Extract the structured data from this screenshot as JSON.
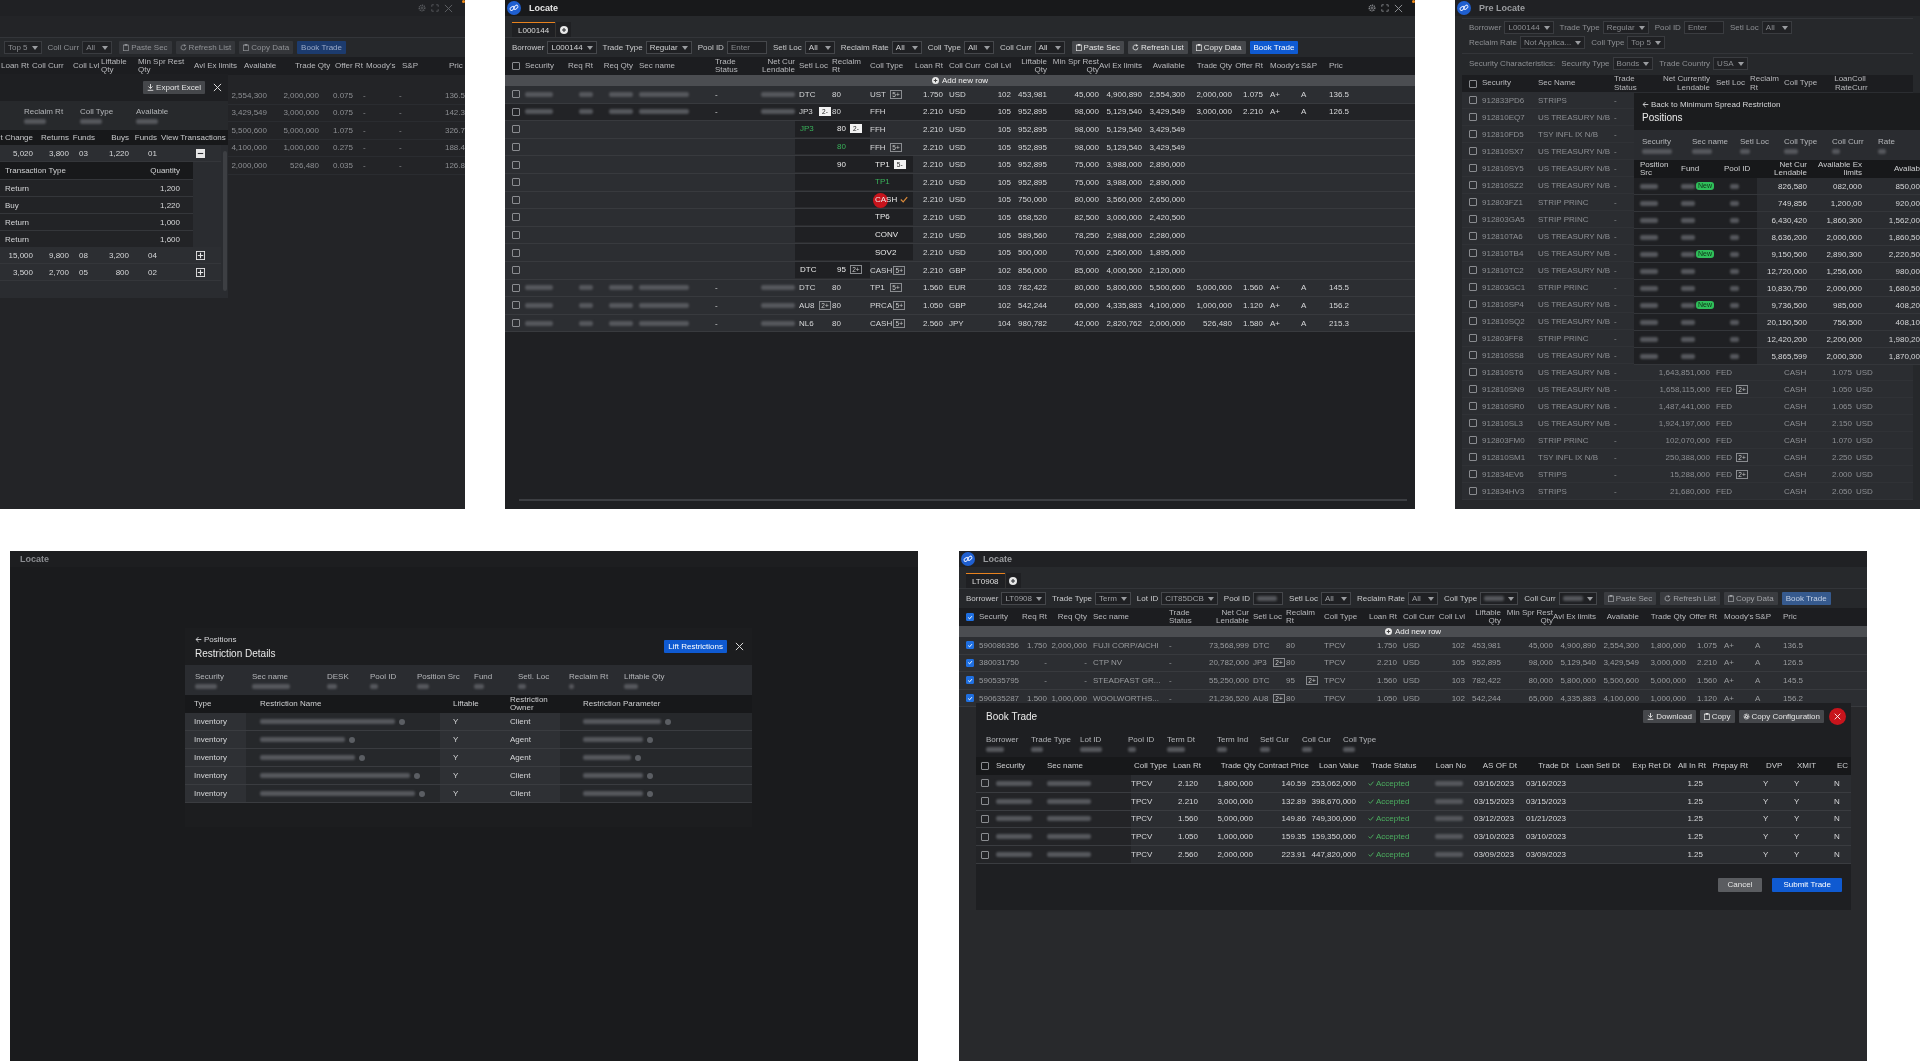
{
  "balances_window": {
    "filters": [
      {
        "value": "Top 5"
      },
      {
        "label": "Coll Curr",
        "value": "All"
      }
    ],
    "buttons": [
      {
        "label": "Paste Sec",
        "kind": "paste"
      },
      {
        "label": "Refresh List",
        "kind": "refresh"
      },
      {
        "label": "Copy Data",
        "kind": "copy"
      },
      {
        "label": "Book Trade",
        "kind": "primary"
      }
    ],
    "columns": [
      "Loan Rt",
      "Coll Curr",
      "Coll Lvl",
      "Liftable Qty",
      "Min Spr Rest Qty",
      "Avl Ex limits",
      "Available",
      "Trade Qty",
      "Offer Rt",
      "Moody's",
      "S&P",
      "Pric"
    ],
    "rows": [
      {
        "available": "2,554,300",
        "trade_qty": "2,000,000",
        "offer_rt": "0.075",
        "moodys": "-",
        "sp": "-",
        "price": "136.5"
      },
      {
        "available": "3,429,549",
        "trade_qty": "3,000,000",
        "offer_rt": "0.075",
        "moodys": "-",
        "sp": "-",
        "price": "142.3"
      },
      {
        "available": "5,500,600",
        "trade_qty": "5,000,000",
        "offer_rt": "1.075",
        "moodys": "-",
        "sp": "-",
        "price": "326.7"
      },
      {
        "available": "4,100,000",
        "trade_qty": "1,000,000",
        "offer_rt": "0.275",
        "moodys": "-",
        "sp": "-",
        "price": "188.4"
      },
      {
        "available": "2,000,000",
        "trade_qty": "526,480",
        "offer_rt": "0.035",
        "moodys": "-",
        "sp": "-",
        "price": "126.8"
      }
    ],
    "drawer": {
      "export_button": "Export Excel",
      "summary": [
        "Reclaim Rt",
        "Coll Type",
        "Available"
      ],
      "columns": [
        "t Change",
        "Returns",
        "Funds",
        "Buys",
        "Funds",
        "View Transactions"
      ],
      "rows": [
        {
          "cells": [
            "5,020",
            "3,800",
            "03",
            "1,220",
            "01"
          ],
          "expanded": true,
          "transactions": {
            "columns": [
              "Transaction Type",
              "Quantity"
            ],
            "rows": [
              [
                "Return",
                "1,200"
              ],
              [
                "Buy",
                "1,220"
              ],
              [
                "Return",
                "1,000"
              ],
              [
                "Return",
                "1,600"
              ]
            ]
          }
        },
        {
          "cells": [
            "15,000",
            "9,800",
            "08",
            "3,200",
            "04"
          ],
          "expanded": false
        },
        {
          "cells": [
            "3,500",
            "2,700",
            "05",
            "800",
            "02"
          ],
          "expanded": false
        }
      ]
    }
  },
  "locate_window": {
    "title": "Locate",
    "tab": {
      "label": "L000144",
      "selected": true
    },
    "filters": [
      {
        "label": "Borrower",
        "value": "L000144"
      },
      {
        "label": "Trade Type",
        "value": "Regular"
      },
      {
        "label": "Pool ID",
        "placeholder": "Enter"
      },
      {
        "label": "Setl Loc",
        "value": "All"
      },
      {
        "label": "Reclaim Rate",
        "value": "All"
      },
      {
        "label": "Coll Type",
        "value": "All"
      },
      {
        "label": "Coll Curr",
        "value": "All"
      }
    ],
    "buttons": [
      {
        "label": "Paste Sec",
        "kind": "paste"
      },
      {
        "label": "Refresh List",
        "kind": "refresh"
      },
      {
        "label": "Copy Data",
        "kind": "copy"
      },
      {
        "label": "Book Trade",
        "kind": "primary"
      }
    ],
    "all_checked": false,
    "columns": [
      "Security",
      "Req Rt",
      "Req Qty",
      "Sec name",
      "Trade Status",
      "Net Cur Lendable",
      "Setl Loc",
      "Reclaim Rt",
      "Coll Type",
      "Loan Rt",
      "Coll Curr",
      "Coll Lvl",
      "Liftable Qty",
      "Min Spr Rest Qty",
      "Avl Ex limits",
      "Available",
      "Trade Qty",
      "Offer Rt",
      "Moody's",
      "S&P",
      "Pric"
    ],
    "add_row": "Add new row",
    "rows": [
      {
        "checked": false,
        "blurred": true,
        "highlighted": false,
        "trade_status": "-",
        "setl_loc": {
          "text": "DTC"
        },
        "reclaim_rt": {
          "text": "80"
        },
        "coll_type": {
          "text": "UST",
          "badge": {
            "text": "5+",
            "expanded": false
          }
        },
        "loan_rt": "1.750",
        "coll_curr": "USD",
        "coll_lvl": "102",
        "liftable_qty": "453,981",
        "min_spr_rest_qty": "45,000",
        "avl_ex_limits": "4,900,890",
        "available": "2,554,300",
        "trade_qty": "2,000,000",
        "offer_rt": "1.075",
        "moodys": "A+",
        "sp": "A",
        "price": "136.5"
      },
      {
        "checked": false,
        "blurred": true,
        "highlighted": true,
        "trade_status": "-",
        "setl_loc": {
          "text": "JP3",
          "badge": {
            "text": "2-",
            "expanded": true
          }
        },
        "reclaim_rt": {
          "text": "80"
        },
        "coll_type": {
          "text": "FFH"
        },
        "loan_rt": "2.210",
        "coll_curr": "USD",
        "coll_lvl": "105",
        "liftable_qty": "952,895",
        "min_spr_rest_qty": "98,000",
        "avl_ex_limits": "5,129,540",
        "available": "3,429,549",
        "trade_qty": "3,000,000",
        "offer_rt": "2.210",
        "moodys": "A+",
        "sp": "A",
        "price": "126.5"
      },
      {
        "checked": false,
        "blurred": false,
        "highlighted": false,
        "setl_loc": {
          "kind": "option",
          "text": "JP3",
          "selected": true
        },
        "reclaim_rt": {
          "kind": "option",
          "text": "80",
          "selected": false,
          "badge": {
            "text": "2-",
            "expanded": true
          }
        },
        "coll_type": {
          "text": "FFH"
        },
        "loan_rt": "2.210",
        "coll_curr": "USD",
        "coll_lvl": "105",
        "liftable_qty": "952,895",
        "min_spr_rest_qty": "98,000",
        "avl_ex_limits": "5,129,540",
        "available": "3,429,549"
      },
      {
        "checked": false,
        "blurred": false,
        "highlighted": false,
        "setl_loc": {
          "kind": "option"
        },
        "reclaim_rt": {
          "kind": "option",
          "text": "80",
          "selected": true
        },
        "coll_type": {
          "text": "FFH",
          "badge": {
            "text": "5+",
            "expanded": false
          }
        },
        "loan_rt": "2.210",
        "coll_curr": "USD",
        "coll_lvl": "105",
        "liftable_qty": "952,895",
        "min_spr_rest_qty": "98,000",
        "avl_ex_limits": "5,129,540",
        "available": "3,429,549"
      },
      {
        "checked": false,
        "blurred": false,
        "highlighted": false,
        "setl_loc": {
          "kind": "option"
        },
        "reclaim_rt": {
          "kind": "option",
          "text": "90",
          "selected": false
        },
        "coll_type": {
          "kind": "option",
          "text": "TP1",
          "selected": false,
          "badge": {
            "text": "5-",
            "expanded": true
          }
        },
        "loan_rt": "2.210",
        "coll_curr": "USD",
        "coll_lvl": "105",
        "liftable_qty": "952,895",
        "min_spr_rest_qty": "75,000",
        "avl_ex_limits": "3,988,000",
        "available": "2,890,000"
      },
      {
        "checked": false,
        "blurred": false,
        "highlighted": false,
        "setl_loc": {
          "kind": "option"
        },
        "reclaim_rt": {
          "kind": "option"
        },
        "coll_type": {
          "kind": "option",
          "text": "TP1",
          "selected": true,
          "checked": false
        },
        "loan_rt": "2.210",
        "coll_curr": "USD",
        "coll_lvl": "105",
        "liftable_qty": "952,895",
        "min_spr_rest_qty": "75,000",
        "avl_ex_limits": "3,988,000",
        "available": "2,890,000"
      },
      {
        "checked": false,
        "blurred": false,
        "highlighted": false,
        "setl_loc": {
          "kind": "option"
        },
        "reclaim_rt": {
          "kind": "option"
        },
        "coll_type": {
          "kind": "option",
          "text": "CASH",
          "selected": false,
          "checked": true,
          "clicked": true
        },
        "loan_rt": "2.210",
        "coll_curr": "USD",
        "coll_lvl": "105",
        "liftable_qty": "750,000",
        "min_spr_rest_qty": "80,000",
        "avl_ex_limits": "3,560,000",
        "available": "2,650,000"
      },
      {
        "checked": false,
        "blurred": false,
        "highlighted": false,
        "setl_loc": {
          "kind": "option"
        },
        "reclaim_rt": {
          "kind": "option"
        },
        "coll_type": {
          "kind": "option",
          "text": "TP6",
          "selected": false,
          "checked": false
        },
        "loan_rt": "2.210",
        "coll_curr": "USD",
        "coll_lvl": "105",
        "liftable_qty": "658,520",
        "min_spr_rest_qty": "82,500",
        "avl_ex_limits": "3,000,000",
        "available": "2,420,500"
      },
      {
        "checked": false,
        "blurred": false,
        "highlighted": false,
        "setl_loc": {
          "kind": "option"
        },
        "reclaim_rt": {
          "kind": "option"
        },
        "coll_type": {
          "kind": "option",
          "text": "CONV",
          "selected": false,
          "checked": false
        },
        "loan_rt": "2.210",
        "coll_curr": "USD",
        "coll_lvl": "105",
        "liftable_qty": "589,560",
        "min_spr_rest_qty": "78,250",
        "avl_ex_limits": "2,988,000",
        "available": "2,280,000"
      },
      {
        "checked": false,
        "blurred": false,
        "highlighted": false,
        "setl_loc": {
          "kind": "option"
        },
        "reclaim_rt": {
          "kind": "option"
        },
        "coll_type": {
          "kind": "option",
          "text": "SOV2",
          "selected": false,
          "checked": false
        },
        "loan_rt": "2.210",
        "coll_curr": "USD",
        "coll_lvl": "105",
        "liftable_qty": "500,000",
        "min_spr_rest_qty": "70,000",
        "avl_ex_limits": "2,560,000",
        "available": "1,895,000"
      },
      {
        "checked": false,
        "blurred": false,
        "highlighted": false,
        "setl_loc": {
          "kind": "option",
          "text": "DTC",
          "selected": false
        },
        "reclaim_rt": {
          "kind": "option",
          "text": "95",
          "selected": false,
          "badge": {
            "text": "2+",
            "expanded": false
          }
        },
        "coll_type": {
          "text": "CASH",
          "badge": {
            "text": "5+",
            "expanded": false
          }
        },
        "loan_rt": "2.210",
        "coll_curr": "GBP",
        "coll_lvl": "102",
        "liftable_qty": "856,000",
        "min_spr_rest_qty": "85,000",
        "avl_ex_limits": "4,000,500",
        "available": "2,120,000"
      },
      {
        "checked": false,
        "blurred": true,
        "highlighted": false,
        "trade_status": "-",
        "setl_loc": {
          "text": "DTC"
        },
        "reclaim_rt": {
          "text": "80"
        },
        "coll_type": {
          "text": "TP1",
          "badge": {
            "text": "5+",
            "expanded": false
          }
        },
        "loan_rt": "1.560",
        "coll_curr": "EUR",
        "coll_lvl": "103",
        "liftable_qty": "782,422",
        "min_spr_rest_qty": "80,000",
        "avl_ex_limits": "5,800,000",
        "available": "5,500,600",
        "trade_qty": "5,000,000",
        "offer_rt": "1.560",
        "moodys": "A+",
        "sp": "A",
        "price": "145.5"
      },
      {
        "checked": false,
        "blurred": true,
        "highlighted": false,
        "trade_status": "-",
        "setl_loc": {
          "text": "AU8",
          "badge": {
            "text": "2+",
            "expanded": false
          }
        },
        "reclaim_rt": {
          "text": "80"
        },
        "coll_type": {
          "text": "PRCA",
          "badge": {
            "text": "5+",
            "expanded": false
          }
        },
        "loan_rt": "1.050",
        "coll_curr": "GBP",
        "coll_lvl": "102",
        "liftable_qty": "542,244",
        "min_spr_rest_qty": "65,000",
        "avl_ex_limits": "4,335,883",
        "available": "4,100,000",
        "trade_qty": "1,000,000",
        "offer_rt": "1.120",
        "moodys": "A+",
        "sp": "A",
        "price": "156.2"
      },
      {
        "checked": false,
        "blurred": true,
        "highlighted": false,
        "trade_status": "-",
        "setl_loc": {
          "text": "NL6"
        },
        "reclaim_rt": {
          "text": "80"
        },
        "coll_type": {
          "text": "CASH",
          "badge": {
            "text": "5+",
            "expanded": false
          }
        },
        "loan_rt": "2.560",
        "coll_curr": "JPY",
        "coll_lvl": "104",
        "liftable_qty": "980,782",
        "min_spr_rest_qty": "42,000",
        "avl_ex_limits": "2,820,762",
        "available": "2,000,000",
        "trade_qty": "526,480",
        "offer_rt": "1.580",
        "moodys": "A+",
        "sp": "A",
        "price": "215.3"
      }
    ]
  },
  "pre_locate_window": {
    "title": "Pre Locate",
    "filters": [
      {
        "label": "Borrower",
        "value": "L000144"
      },
      {
        "label": "Trade Type",
        "value": "Regular"
      },
      {
        "label": "Pool ID",
        "placeholder": "Enter"
      },
      {
        "label": "Setl Loc",
        "value": "All"
      },
      {
        "label": "Reclaim Rate",
        "value": "Not Applica..."
      },
      {
        "label": "Coll Type",
        "value": "Top 5"
      }
    ],
    "characteristics": {
      "label": "Security Characteristics:",
      "filters": [
        {
          "label": "Security Type",
          "value": "Bonds"
        },
        {
          "label": "Trade Country",
          "value": "USA"
        }
      ]
    },
    "all_checked": false,
    "columns": [
      "Security",
      "Sec Name",
      "Trade Status",
      "Net Currently Lendable",
      "Setl Loc",
      "Reclaim Rt",
      "Coll Type",
      "Loan Rate",
      "Coll Curr"
    ],
    "rows": [
      {
        "checked": false,
        "security": "912833PD6",
        "sec_name": "STRIPS",
        "trade_status": "-"
      },
      {
        "checked": false,
        "security": "912810EQ7",
        "sec_name": "US TREASURY N/B",
        "trade_status": "-"
      },
      {
        "checked": false,
        "security": "912810FD5",
        "sec_name": "TSY INFL IX N/B",
        "trade_status": "-"
      },
      {
        "checked": false,
        "security": "912810SX7",
        "sec_name": "US TREASURY N/B",
        "trade_status": "-"
      },
      {
        "checked": false,
        "security": "912810SY5",
        "sec_name": "US TREASURY N/B",
        "trade_status": "-"
      },
      {
        "checked": false,
        "security": "912810SZ2",
        "sec_name": "US TREASURY N/B",
        "trade_status": "-"
      },
      {
        "checked": false,
        "security": "912803FZ1",
        "sec_name": "STRIP PRINC",
        "trade_status": "-"
      },
      {
        "checked": false,
        "security": "912803GA5",
        "sec_name": "STRIP PRINC",
        "trade_status": "-"
      },
      {
        "checked": false,
        "security": "912810TA6",
        "sec_name": "US TREASURY N/B",
        "trade_status": "-"
      },
      {
        "checked": false,
        "security": "912810TB4",
        "sec_name": "US TREASURY N/B",
        "trade_status": "-"
      },
      {
        "checked": false,
        "security": "912810TC2",
        "sec_name": "US TREASURY N/B",
        "trade_status": "-"
      },
      {
        "checked": false,
        "security": "912803GC1",
        "sec_name": "STRIP PRINC",
        "trade_status": "-"
      },
      {
        "checked": false,
        "security": "912810SP4",
        "sec_name": "US TREASURY N/B",
        "trade_status": "-"
      },
      {
        "checked": false,
        "security": "912810SQ2",
        "sec_name": "US TREASURY N/B",
        "trade_status": "-"
      },
      {
        "checked": false,
        "security": "912803FF8",
        "sec_name": "STRIP PRINC",
        "trade_status": "-"
      },
      {
        "checked": false,
        "security": "912810SS8",
        "sec_name": "US TREASURY N/B",
        "trade_status": "-"
      },
      {
        "checked": false,
        "security": "912810ST6",
        "sec_name": "US TREASURY N/B",
        "trade_status": "-",
        "net_currently_lendable": "1,643,851,000",
        "setl_loc": "FED",
        "coll_type": "CASH",
        "loan_rate": "1.075",
        "coll_curr": "USD"
      },
      {
        "checked": false,
        "security": "912810SN9",
        "sec_name": "US TREASURY N/B",
        "trade_status": "-",
        "net_currently_lendable": "1,658,115,000",
        "setl_loc": "FED",
        "badge": "2+",
        "coll_type": "CASH",
        "loan_rate": "1.050",
        "coll_curr": "USD"
      },
      {
        "checked": false,
        "security": "912810SR0",
        "sec_name": "US TREASURY N/B",
        "trade_status": "-",
        "net_currently_lendable": "1,487,441,000",
        "setl_loc": "FED",
        "coll_type": "CASH",
        "loan_rate": "1.065",
        "coll_curr": "USD"
      },
      {
        "checked": false,
        "security": "912810SL3",
        "sec_name": "US TREASURY N/B",
        "trade_status": "-",
        "net_currently_lendable": "1,924,197,000",
        "setl_loc": "FED",
        "coll_type": "CASH",
        "loan_rate": "2.150",
        "coll_curr": "USD"
      },
      {
        "checked": false,
        "security": "912803FM0",
        "sec_name": "STRIP PRINC",
        "trade_status": "-",
        "net_currently_lendable": "102,070,000",
        "setl_loc": "FED",
        "coll_type": "CASH",
        "loan_rate": "1.070",
        "coll_curr": "USD"
      },
      {
        "checked": false,
        "security": "912810SM1",
        "sec_name": "TSY INFL IX N/B",
        "trade_status": "-",
        "net_currently_lendable": "250,388,000",
        "setl_loc": "FED",
        "badge": "2+",
        "coll_type": "CASH",
        "loan_rate": "2.250",
        "coll_curr": "USD"
      },
      {
        "checked": false,
        "security": "912834EV6",
        "sec_name": "STRIPS",
        "trade_status": "-",
        "net_currently_lendable": "15,288,000",
        "setl_loc": "FED",
        "badge": "2+",
        "coll_type": "CASH",
        "loan_rate": "2.000",
        "coll_curr": "USD"
      },
      {
        "checked": false,
        "security": "912834HV3",
        "sec_name": "STRIPS",
        "trade_status": "-",
        "net_currently_lendable": "21,680,000",
        "setl_loc": "FED",
        "coll_type": "CASH",
        "loan_rate": "2.050",
        "coll_curr": "USD"
      }
    ],
    "positions": {
      "back_link": "Back to Minimum Spread Restriction",
      "title": "Positions",
      "summary": [
        "Security",
        "Sec name",
        "Setl Loc",
        "Coll Type",
        "Coll Curr",
        "Rate"
      ],
      "columns": [
        "Position Src",
        "Fund",
        "Pool ID",
        "Net Cur Lendable",
        "Available Ex limits",
        "Availab"
      ],
      "rows": [
        {
          "badge": "New",
          "net_cur_lendable": "826,580",
          "available_ex_limits": "082,000",
          "available": "850,00"
        },
        {
          "net_cur_lendable": "749,856",
          "available_ex_limits": "1,200,00",
          "available": "920,00"
        },
        {
          "net_cur_lendable": "6,430,420",
          "available_ex_limits": "1,860,300",
          "available": "1,562,00"
        },
        {
          "net_cur_lendable": "8,636,200",
          "available_ex_limits": "2,000,000",
          "available": "1,860,50"
        },
        {
          "badge": "New",
          "net_cur_lendable": "9,150,500",
          "available_ex_limits": "2,890,300",
          "available": "2,220,50"
        },
        {
          "net_cur_lendable": "12,720,000",
          "available_ex_limits": "1,256,000",
          "available": "980,00"
        },
        {
          "net_cur_lendable": "10,830,750",
          "available_ex_limits": "2,000,000",
          "available": "1,680,50"
        },
        {
          "badge": "New",
          "net_cur_lendable": "9,736,500",
          "available_ex_limits": "985,000",
          "available": "408,20"
        },
        {
          "net_cur_lendable": "20,150,500",
          "available_ex_limits": "756,500",
          "available": "408,10"
        },
        {
          "net_cur_lendable": "12,420,200",
          "available_ex_limits": "2,200,000",
          "available": "1,980,20"
        },
        {
          "net_cur_lendable": "5,865,599",
          "available_ex_limits": "2,000,300",
          "available": "1,870,00"
        }
      ]
    }
  },
  "restriction_window": {
    "title": "Locate",
    "dialog": {
      "back_link": "Positions",
      "title": "Restriction Details",
      "button": "Lift Restrictions",
      "summary": [
        "Security",
        "Sec name",
        "DESK",
        "Pool ID",
        "Position Src",
        "Fund",
        "Setl. Loc",
        "Reclaim Rt",
        "Liftable Qty"
      ],
      "columns": [
        "Type",
        "Restriction Name",
        "Liftable",
        "Restriction Owner",
        "Restriction Parameter"
      ],
      "rows": [
        {
          "type": "Inventory",
          "liftable": "Y",
          "owner": "Client"
        },
        {
          "type": "Inventory",
          "liftable": "Y",
          "owner": "Agent"
        },
        {
          "type": "Inventory",
          "liftable": "Y",
          "owner": "Agent"
        },
        {
          "type": "Inventory",
          "liftable": "Y",
          "owner": "Client"
        },
        {
          "type": "Inventory",
          "liftable": "Y",
          "owner": "Client"
        }
      ]
    }
  },
  "book_trade_window": {
    "title": "Locate",
    "tab": {
      "label": "LT0908",
      "selected": true
    },
    "filters": [
      {
        "label": "Borrower",
        "value": "LT0908"
      },
      {
        "label": "Trade Type",
        "value": "Term"
      },
      {
        "label": "Lot ID",
        "value": "CIT85DCB"
      },
      {
        "label": "Pool ID",
        "kind": "input",
        "blurred": true
      },
      {
        "label": "Setl Loc",
        "value": "All"
      },
      {
        "label": "Reclaim Rate",
        "value": "All"
      },
      {
        "label": "Coll Type",
        "kind": "select",
        "blurred": true
      },
      {
        "label": "Coll Curr",
        "kind": "select",
        "blurred": true
      }
    ],
    "buttons": [
      {
        "label": "Paste Sec",
        "kind": "paste"
      },
      {
        "label": "Refresh List",
        "kind": "refresh"
      },
      {
        "label": "Copy Data",
        "kind": "copy"
      },
      {
        "label": "Book Trade",
        "kind": "primary"
      }
    ],
    "all_checked": true,
    "columns": [
      "Security",
      "Req Rt",
      "Req Qty",
      "Sec name",
      "Trade Status",
      "Net Cur Lendable",
      "Setl Loc",
      "Reclaim Rt",
      "Coll Type",
      "Loan Rt",
      "Coll Curr",
      "Coll Lvl",
      "Liftable Qty",
      "Min Spr Rest Qty",
      "Avl Ex limits",
      "Available",
      "Trade Qty",
      "Offer Rt",
      "Moody's",
      "S&P",
      "Pric"
    ],
    "add_row": "Add new row",
    "rows": [
      {
        "checked": true,
        "security": "590086356",
        "req_rt": "1.750",
        "req_qty": "2,000,000",
        "sec_name": "FUJI CORP/AICHI",
        "trade_status": "-",
        "net_cur_lendable": "73,568,999",
        "setl_loc": {
          "text": "DTC"
        },
        "reclaim_rt": {
          "text": "80"
        },
        "coll_type": {
          "text": "TPCV"
        },
        "loan_rt": "1.750",
        "coll_curr": "USD",
        "coll_lvl": "102",
        "liftable_qty": "453,981",
        "min_spr_rest_qty": "45,000",
        "avl_ex_limits": "4,900,890",
        "available": "2,554,300",
        "trade_qty": "1,800,000",
        "offer_rt": "1.075",
        "moodys": "A+",
        "sp": "A",
        "price": "136.5"
      },
      {
        "checked": true,
        "security": "380031750",
        "req_rt": "-",
        "req_qty": "-",
        "sec_name": "CTP NV",
        "trade_status": "-",
        "net_cur_lendable": "20,782,000",
        "setl_loc": {
          "text": "JP3",
          "badge": {
            "text": "2+",
            "expanded": false
          }
        },
        "reclaim_rt": {
          "text": "80"
        },
        "coll_type": {
          "text": "TPCV"
        },
        "loan_rt": "2.210",
        "coll_curr": "USD",
        "coll_lvl": "105",
        "liftable_qty": "952,895",
        "min_spr_rest_qty": "98,000",
        "avl_ex_limits": "5,129,540",
        "available": "3,429,549",
        "trade_qty": "3,000,000",
        "offer_rt": "2.210",
        "moodys": "A+",
        "sp": "A",
        "price": "126.5"
      },
      {
        "checked": true,
        "security": "590535795",
        "req_rt": "-",
        "req_qty": "-",
        "sec_name": "STEADFAST GR...",
        "trade_status": "-",
        "net_cur_lendable": "55,250,000",
        "setl_loc": {
          "text": "DTC"
        },
        "reclaim_rt": {
          "text": "95",
          "badge": {
            "text": "2+",
            "expanded": false
          }
        },
        "coll_type": {
          "text": "TPCV"
        },
        "loan_rt": "1.560",
        "coll_curr": "USD",
        "coll_lvl": "103",
        "liftable_qty": "782,422",
        "min_spr_rest_qty": "80,000",
        "avl_ex_limits": "5,800,000",
        "available": "5,500,600",
        "trade_qty": "5,000,000",
        "offer_rt": "1.560",
        "moodys": "A+",
        "sp": "A",
        "price": "145.5"
      },
      {
        "checked": true,
        "security": "590635287",
        "req_rt": "1.500",
        "req_qty": "1,000,000",
        "sec_name": "WOOLWORTHS...",
        "trade_status": "-",
        "net_cur_lendable": "21,236,520",
        "setl_loc": {
          "text": "AU8",
          "badge": {
            "text": "2+",
            "expanded": false
          }
        },
        "reclaim_rt": {
          "text": "80"
        },
        "coll_type": {
          "text": "TPCV"
        },
        "loan_rt": "1.050",
        "coll_curr": "USD",
        "coll_lvl": "102",
        "liftable_qty": "542,244",
        "min_spr_rest_qty": "65,000",
        "avl_ex_limits": "4,335,883",
        "available": "4,100,000",
        "trade_qty": "1,000,000",
        "offer_rt": "1.120",
        "moodys": "A+",
        "sp": "A",
        "price": "156.2"
      }
    ],
    "dialog": {
      "title": "Book Trade",
      "buttons": [
        {
          "label": "Download",
          "kind": "download"
        },
        {
          "label": "Copy",
          "kind": "copy"
        },
        {
          "label": "Copy Configuration",
          "kind": "settings"
        }
      ],
      "summary": [
        "Borrower",
        "Trade Type",
        "Lot ID",
        "Pool ID",
        "Term Dt",
        "Term Ind",
        "Setl Cur",
        "Coll Cur",
        "Coll Type"
      ],
      "all_checked": false,
      "columns": [
        "Security",
        "Sec name",
        "Coll  Type",
        "Loan Rt",
        "Trade Qty",
        "Contract Price",
        "Loan Value",
        "Trade Status",
        "Loan No",
        "AS OF Dt",
        "Trade Dt",
        "Loan Setl Dt",
        "Exp Ret Dt",
        "All In Rt",
        "Prepay Rt",
        "DVP",
        "XMIT",
        "EC"
      ],
      "rows": [
        {
          "checked": false,
          "coll_type": "TPCV",
          "loan_rt": "2.120",
          "trade_qty": "1,800,000",
          "contract_price": "140.59",
          "loan_value": "253,062,000",
          "trade_status": "Accepted",
          "as_of_dt": "03/16/2023",
          "trade_dt": "03/16/2023",
          "all_in_rt": "1.25",
          "dvp": "Y",
          "xmit": "Y",
          "ec": "N"
        },
        {
          "checked": false,
          "coll_type": "TPCV",
          "loan_rt": "2.210",
          "trade_qty": "3,000,000",
          "contract_price": "132.89",
          "loan_value": "398,670,000",
          "trade_status": "Accepted",
          "as_of_dt": "03/15/2023",
          "trade_dt": "03/15/2023",
          "all_in_rt": "1.25",
          "dvp": "Y",
          "xmit": "Y",
          "ec": "N"
        },
        {
          "checked": false,
          "coll_type": "TPCV",
          "loan_rt": "1.560",
          "trade_qty": "5,000,000",
          "contract_price": "149.86",
          "loan_value": "749,300,000",
          "trade_status": "Accepted",
          "as_of_dt": "03/12/2023",
          "trade_dt": "01/21/2023",
          "all_in_rt": "1.25",
          "dvp": "Y",
          "xmit": "Y",
          "ec": "N"
        },
        {
          "checked": false,
          "coll_type": "TPCV",
          "loan_rt": "1.050",
          "trade_qty": "1,000,000",
          "contract_price": "159.35",
          "loan_value": "159,350,000",
          "trade_status": "Accepted",
          "as_of_dt": "03/10/2023",
          "trade_dt": "03/10/2023",
          "all_in_rt": "1.25",
          "dvp": "Y",
          "xmit": "Y",
          "ec": "N"
        },
        {
          "checked": false,
          "coll_type": "TPCV",
          "loan_rt": "2.560",
          "trade_qty": "2,000,000",
          "contract_price": "223.91",
          "loan_value": "447,820,000",
          "trade_status": "Accepted",
          "as_of_dt": "03/09/2023",
          "trade_dt": "03/09/2023",
          "all_in_rt": "1.25",
          "dvp": "Y",
          "xmit": "Y",
          "ec": "N"
        }
      ],
      "cancel": "Cancel",
      "submit": "Submit Trade"
    }
  }
}
